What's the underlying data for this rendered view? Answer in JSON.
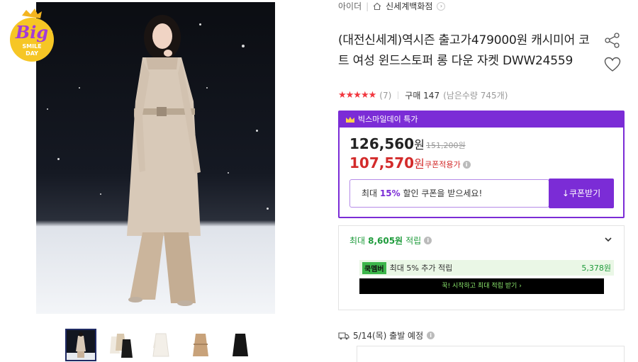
{
  "badge": {
    "line1": "Big",
    "line2": "SMILE",
    "line3": "DAY"
  },
  "breadcrumb": {
    "brand": "아이더",
    "store": "신세계백화점"
  },
  "product": {
    "title": "(대전신세계)역시즌 출고가479000원 캐시미어 코트 여성 윈드스토퍼 롱 다운 자켓 DWW24559",
    "stars": "★★★★★",
    "review_count": "(7)",
    "purchase": "구매 147",
    "remaining": "(남은수량 745개)"
  },
  "price_box": {
    "header": "빅스마일데이 특가",
    "price": "126,560",
    "won": "원",
    "original_price": "151,200원",
    "coupon_price": "107,570",
    "coupon_label": "쿠폰적용가",
    "coupon_text_pre": "최대 ",
    "coupon_pct": "15%",
    "coupon_text_post": " 할인 쿠폰을 받으세요!",
    "coupon_button": "↓쿠폰받기"
  },
  "points": {
    "head_pre": "최대 ",
    "head_amount": "8,605원",
    "head_post": " 적립",
    "member_tag": "쿡멤버",
    "member_text": "최대 5% 추가 적립",
    "member_amount": "5,378원",
    "cta": "꾹! 시작하고 최대 적립 받기 ›"
  },
  "shipping": {
    "text": "5/14(목) 출발 예정"
  },
  "colors": {
    "accent": "#7b2cd6",
    "sale": "#d32b2b",
    "green": "#1e9b3b"
  },
  "icons": [
    "home-icon",
    "chevron-right-icon",
    "share-icon",
    "heart-icon",
    "crown-icon",
    "info-icon",
    "chevron-down-icon",
    "truck-icon"
  ]
}
